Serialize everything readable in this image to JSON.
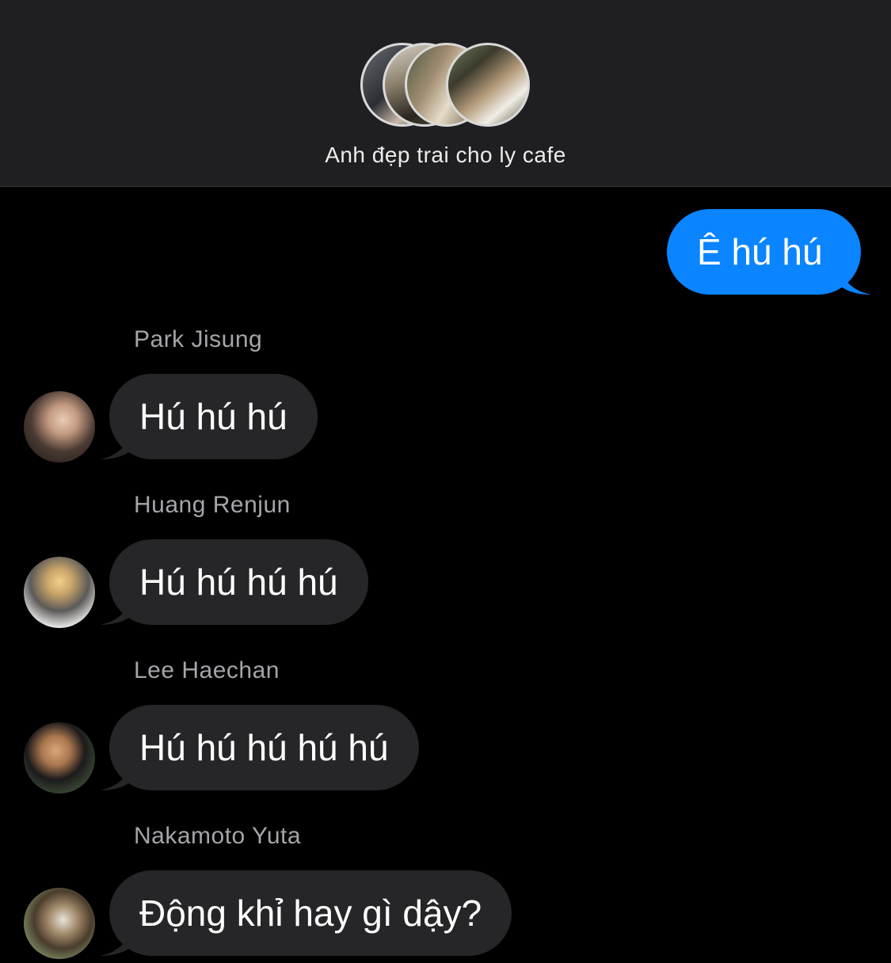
{
  "header": {
    "title": "Anh đẹp trai cho ly cafe",
    "group_avatar_icons": [
      "member-avatar-1",
      "member-avatar-2",
      "member-avatar-3",
      "member-avatar-4"
    ]
  },
  "colors": {
    "outgoing_bubble": "#0a84ff",
    "incoming_bubble": "#262628",
    "header_bg": "#1f1f21",
    "background": "#000000",
    "sender_name": "#a5a5aa"
  },
  "messages": [
    {
      "direction": "outgoing",
      "text": "Ê hú hú"
    },
    {
      "direction": "incoming",
      "sender": "Park Jisung",
      "text": "Hú hú hú"
    },
    {
      "direction": "incoming",
      "sender": "Huang Renjun",
      "text": "Hú hú hú hú"
    },
    {
      "direction": "incoming",
      "sender": "Lee Haechan",
      "text": "Hú hú hú hú hú"
    },
    {
      "direction": "incoming",
      "sender": "Nakamoto Yuta",
      "text": "Động khỉ hay gì dậy?"
    }
  ]
}
